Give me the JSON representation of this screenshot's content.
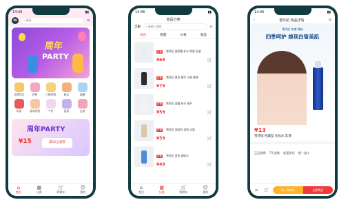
{
  "phone1": {
    "time": "14:46",
    "logo": "ib",
    "search_placeholder": "搜索",
    "hero_cn": "周年",
    "hero_en": "PARTY",
    "categories": [
      {
        "label": "品牌特卖",
        "color": "#f6c86a"
      },
      {
        "label": "护肤",
        "color": "#f3a9c4"
      },
      {
        "label": "口碑好物",
        "color": "#f5d27c"
      },
      {
        "label": "新品",
        "color": "#f6b07a"
      },
      {
        "label": "面膜",
        "color": "#aad6f2"
      },
      {
        "label": "彩妆",
        "color": "#e85a5a"
      },
      {
        "label": "身体护理",
        "color": "#f7c7a1"
      },
      {
        "label": "个护",
        "color": "#f0d9f0"
      },
      {
        "label": "香氛",
        "color": "#c7b1ec"
      },
      {
        "label": "全部",
        "color": "#f2a5b6"
      }
    ],
    "banner2_title": "周年PARTY",
    "banner2_price": "¥15",
    "banner2_coupon": "满15立减券",
    "tabs": [
      "首页",
      "分类",
      "购物车",
      "我的"
    ]
  },
  "phone2": {
    "time": "14:46",
    "title": "商品分类",
    "left_label": "全部",
    "search_placeholder": "请输入搜索",
    "filters": [
      "综合",
      "销量",
      "价格",
      "新品"
    ],
    "items": [
      {
        "tag": "自营",
        "desc": "雪玲妃 玻尿酸 补水 保湿 乳液",
        "price": "¥69",
        "color": "#e8eef2"
      },
      {
        "tag": "自营",
        "desc": "雪玲妃 黑色 精华 小瓶 套装",
        "price": "¥79",
        "color": "#2b2b2b"
      },
      {
        "tag": "自营",
        "desc": "雪玲妃 面霜 补水 修护",
        "price": "¥59",
        "color": "#f3f3f3"
      },
      {
        "tag": "自营",
        "desc": "雪玲妃 洗面奶 温和 洁面",
        "price": "¥59",
        "color": "#d8c9a8"
      },
      {
        "tag": "自营",
        "desc": "雪玲妃 蓝色 爽肤水",
        "price": "¥49",
        "color": "#4f8ad6"
      }
    ],
    "tabs": [
      "首页",
      "分类",
      "购物车",
      "我的"
    ]
  },
  "phone3": {
    "time": "14:46",
    "title": "雪玲妃 商品详情",
    "brand_line": "雪玲妃 年度 焕新",
    "headline": "四季呵护 焕现白皙美肌",
    "price": "¥13",
    "name": "雪玲妃 经典型 化妆水 乳液",
    "options": [
      "正品保障",
      "7天退换",
      "极速发货",
      "假一赔十"
    ],
    "buy_cart": "加入购物车",
    "buy_now": "立即购买",
    "bar_icons": [
      "店铺",
      "购物车"
    ]
  }
}
